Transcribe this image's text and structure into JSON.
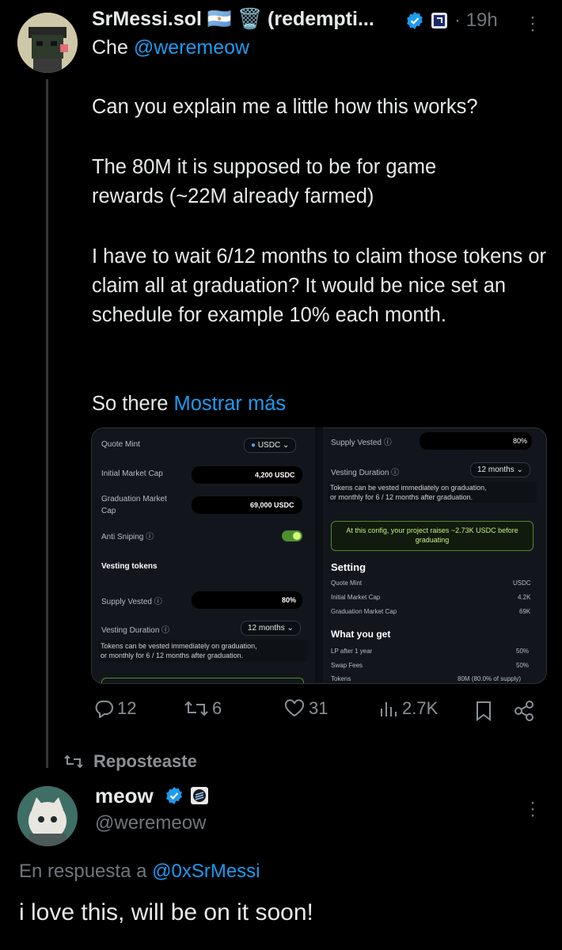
{
  "tweet": {
    "display_name": "SrMessi.sol 🇦🇷 🗑️ (redempti...",
    "time": "· 19h",
    "reply_prefix": "Che",
    "reply_handle": "@weremeow",
    "paragraphs": [
      "Can you explain me a little how this works?",
      "The 80M it is supposed to be for game rewards (~22M already farmed)",
      "I have to wait 6/12 months to claim those tokens or claim all at graduation? It would be nice set an schedule for example 10% each month.",
      "So there"
    ],
    "show_more": "Mostrar más",
    "stats": {
      "replies": "12",
      "reposts": "6",
      "likes": "31",
      "views": "2.7K"
    }
  },
  "media": {
    "left": {
      "quote_mint_label": "Quote Mint",
      "quote_mint_value": "USDC",
      "initial_mc_label": "Initial Market Cap",
      "initial_mc_value": "4,200 USDC",
      "grad_mc_label_1": "Graduation Market",
      "grad_mc_label_2": "Cap",
      "grad_mc_value": "69,000 USDC",
      "anti_sniping_label": "Anti Sniping ⓘ",
      "vesting_tokens_label": "Vesting tokens",
      "supply_vested_label": "Supply Vested ⓘ",
      "supply_vested_value": "80%",
      "vesting_duration_label": "Vesting Duration ⓘ",
      "vesting_duration_value": "12 months",
      "tooltip_1": "Tokens can be vested immediately on graduation,",
      "tooltip_2": "or monthly for 6 / 12 months after graduation."
    },
    "right": {
      "supply_vested_label": "Supply Vested ⓘ",
      "supply_vested_value": "80%",
      "vesting_duration_label": "Vesting Duration ⓘ",
      "vesting_duration_value": "12 months",
      "tooltip_1": "Tokens can be vested immediately on graduation,",
      "tooltip_2": "or monthly for 6 / 12 months after graduation.",
      "banner": "At this config, your project raises ~2.73K USDC before graduating",
      "setting_title": "Setting",
      "settings": [
        {
          "label": "Quote Mint",
          "value": "USDC"
        },
        {
          "label": "Initial Market Cap",
          "value": "4.2K"
        },
        {
          "label": "Graduation Market Cap",
          "value": "69K"
        }
      ],
      "what_title": "What you get",
      "what": [
        {
          "label": "LP after 1 year",
          "value": "50%"
        },
        {
          "label": "Swap Fees",
          "value": "50%"
        },
        {
          "label": "Tokens",
          "value": "80M (80.0% of supply)"
        }
      ]
    }
  },
  "repost_label": "Reposteaste",
  "reply": {
    "display_name": "meow",
    "handle": "@weremeow",
    "in_reply_prefix": "En respuesta a",
    "in_reply_handle": "@0xSrMessi",
    "text": "i love this, will be on it soon!"
  },
  "colors": {
    "accent": "#1d9bf0",
    "muted": "#71767b",
    "background": "#000000"
  }
}
